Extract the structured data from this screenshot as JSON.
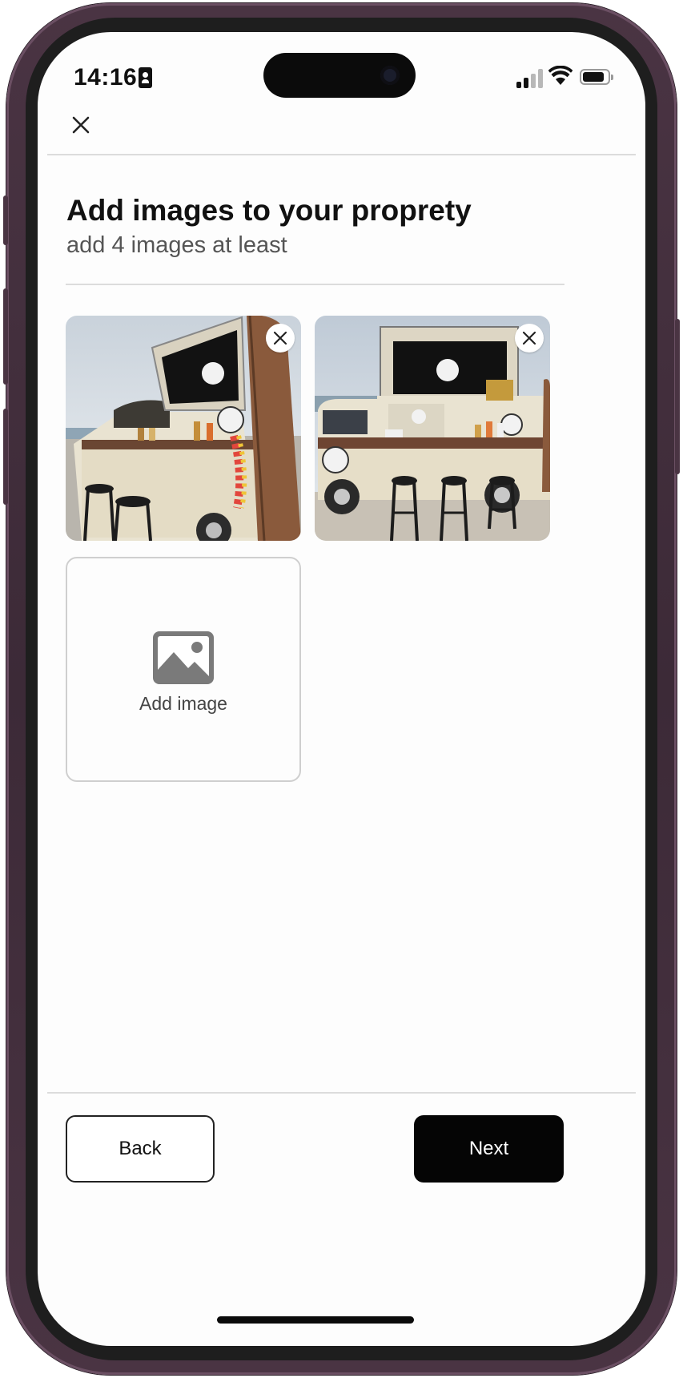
{
  "status_bar": {
    "time": "14:16",
    "icons": [
      "person-badge-icon",
      "cellular-signal-icon",
      "wifi-icon",
      "battery-icon"
    ]
  },
  "header": {
    "close_icon": "close-icon"
  },
  "content": {
    "title": "Add images to your proprety",
    "subtitle": "add 4 images at least",
    "photos": [
      {
        "remove_icon": "close-icon"
      },
      {
        "remove_icon": "close-icon"
      }
    ],
    "add_image": {
      "label": "Add image",
      "icon": "image-icon"
    }
  },
  "footer": {
    "back_label": "Back",
    "next_label": "Next"
  },
  "colors": {
    "primary_button": "#050505",
    "divider": "#dcdcdc",
    "frame": "#4a3443",
    "screen_background": "#fdfdfd"
  }
}
